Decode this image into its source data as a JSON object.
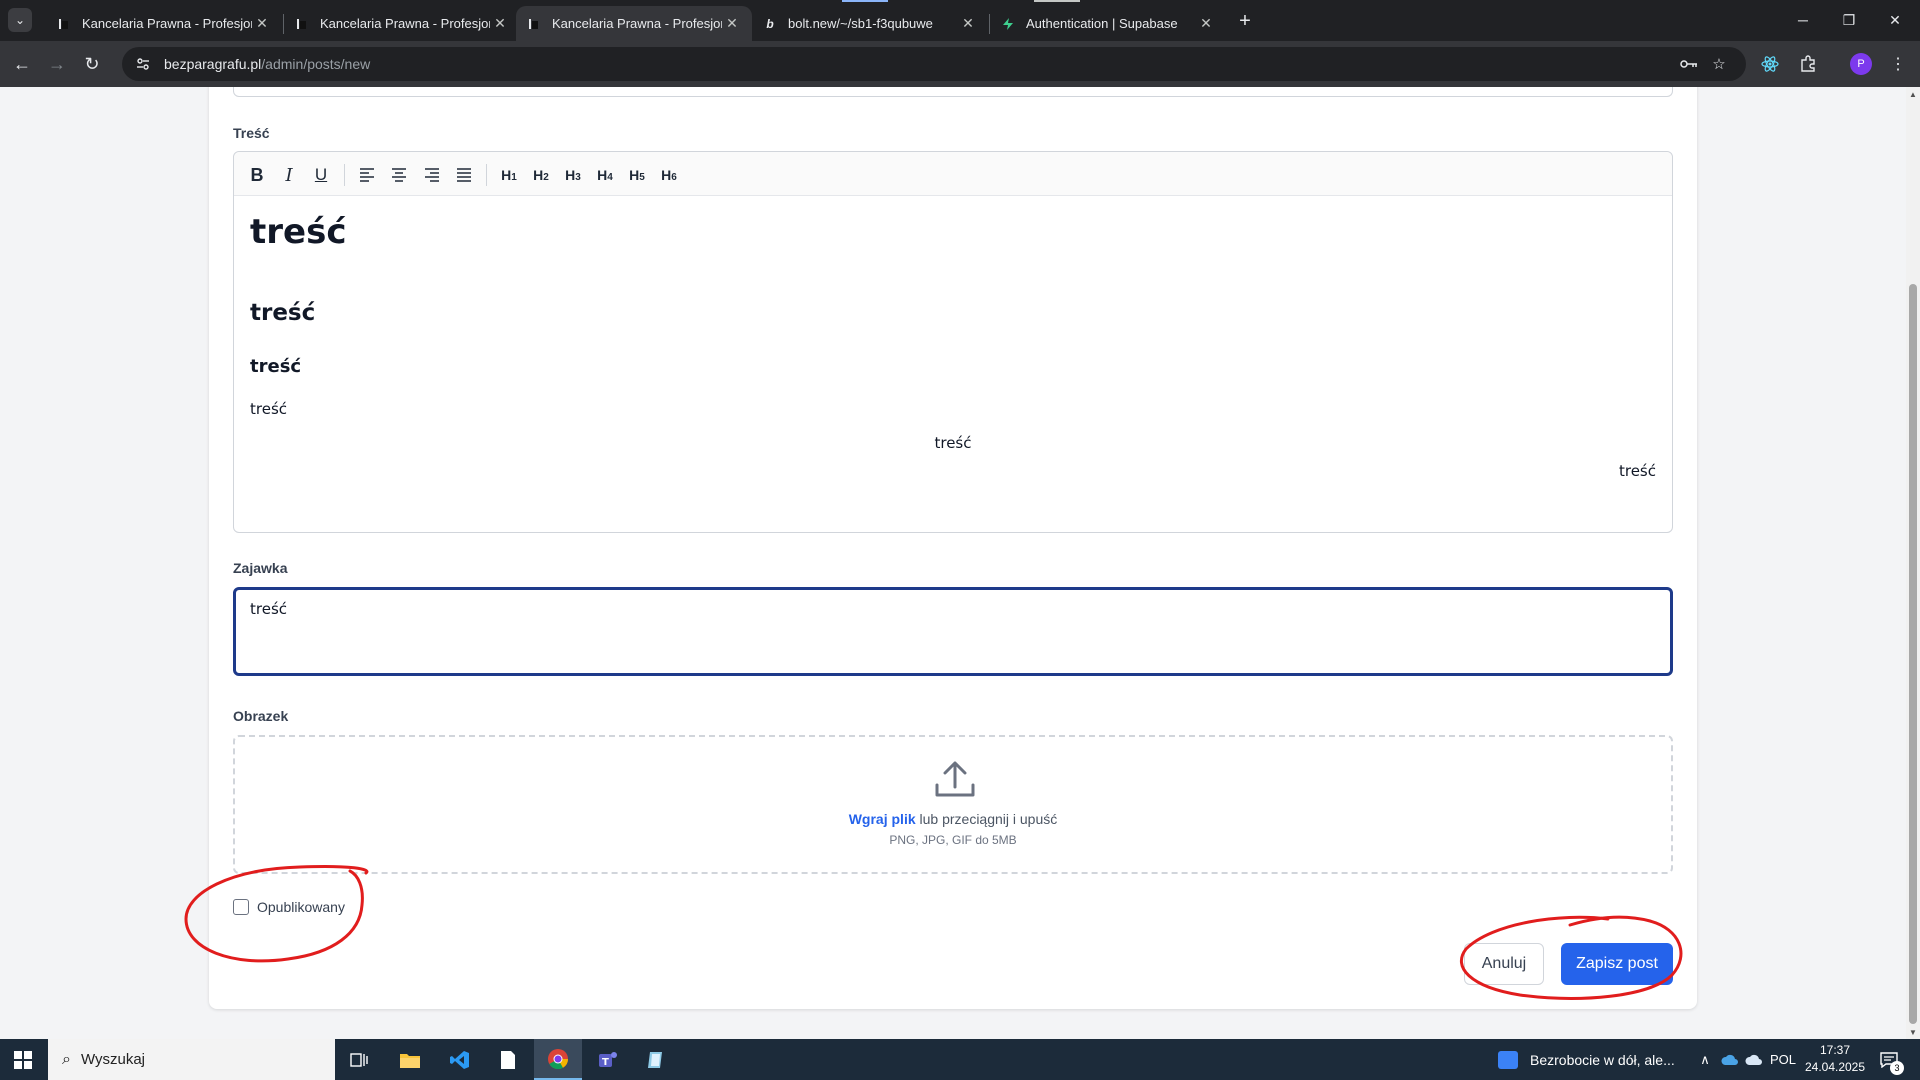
{
  "browser": {
    "tabs": [
      {
        "title": "Kancelaria Prawna - Profesjonal",
        "favicon": "site-favicon"
      },
      {
        "title": "Kancelaria Prawna - Profesjonal",
        "favicon": "site-favicon"
      },
      {
        "title": "Kancelaria Prawna - Profesjonal",
        "favicon": "site-favicon",
        "active": true
      },
      {
        "title": "bolt.new/~/sb1-f3qubuwe",
        "favicon": "bolt-favicon",
        "favicon_text": "b"
      },
      {
        "title": "Authentication | Supabase",
        "favicon": "supabase-favicon"
      }
    ],
    "url_host": "bezparagrafu.pl",
    "url_path": "/admin/posts/new",
    "profile_initial": "P"
  },
  "form": {
    "content_label": "Treść",
    "editor_toolbar": {
      "bold": "B",
      "italic": "I",
      "underline": "U",
      "headings": [
        {
          "letter": "H",
          "level": "1"
        },
        {
          "letter": "H",
          "level": "2"
        },
        {
          "letter": "H",
          "level": "3"
        },
        {
          "letter": "H",
          "level": "4"
        },
        {
          "letter": "H",
          "level": "5"
        },
        {
          "letter": "H",
          "level": "6"
        }
      ]
    },
    "editor_lines": [
      {
        "text": "treść",
        "style": "h1",
        "align": "left"
      },
      {
        "text": "treść",
        "style": "h2",
        "align": "left"
      },
      {
        "text": "treść",
        "style": "h3",
        "align": "left"
      },
      {
        "text": "treść",
        "style": "p",
        "align": "left"
      },
      {
        "text": "treść",
        "style": "p",
        "align": "center"
      },
      {
        "text": "treść",
        "style": "p",
        "align": "right"
      }
    ],
    "excerpt_label": "Zajawka",
    "excerpt_value": "treść",
    "image_label": "Obrazek",
    "upload_link": "Wgraj plik",
    "upload_text": " lub przeciągnij i upuść",
    "upload_hint": "PNG, JPG, GIF do 5MB",
    "published_label": "Opublikowany",
    "published_checked": false,
    "cancel_label": "Anuluj",
    "save_label": "Zapisz post",
    "accent_color": "#2563eb"
  },
  "taskbar": {
    "search_placeholder": "Wyszukaj",
    "news_text": "Bezrobocie w dół, ale...",
    "language": "POL",
    "time": "17:37",
    "date": "24.04.2025",
    "notification_count": "3"
  }
}
